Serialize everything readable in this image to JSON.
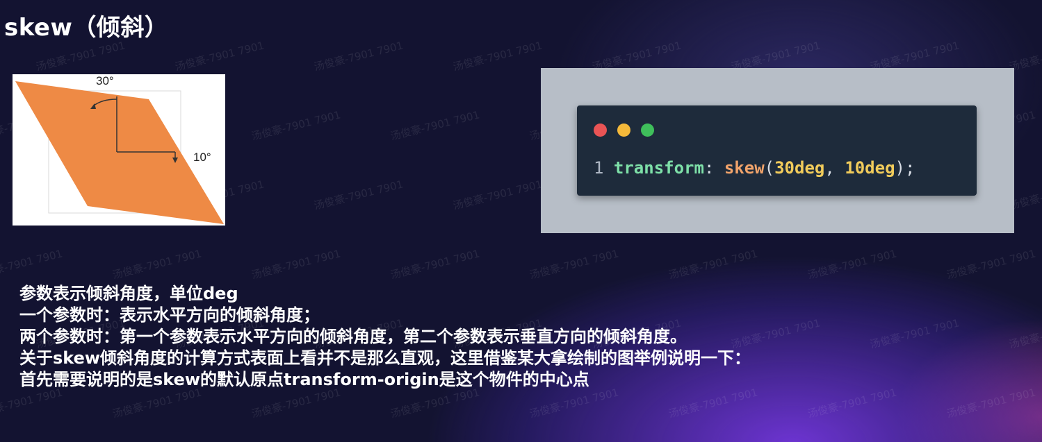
{
  "slide": {
    "title": "skew（倾斜）",
    "colors": {
      "diagram_shape": "#ee8a45",
      "code_panel_bg": "#b7bec7",
      "code_window_bg": "#1e2b3b",
      "dot_red": "#ea5455",
      "dot_yellow": "#f5b93a",
      "dot_green": "#3fbf5b"
    }
  },
  "diagram": {
    "angle_x_label": "30°",
    "angle_y_label": "10°"
  },
  "code": {
    "line_number": "1",
    "property": "transform",
    "colon": ":",
    "function": "skew",
    "open_paren": "(",
    "arg1": "30deg",
    "comma": ",",
    "arg2": "10deg",
    "close": ");"
  },
  "description": [
    "参数表示倾斜角度，单位deg",
    "一个参数时：表示水平方向的倾斜角度；",
    "两个参数时：第一个参数表示水平方向的倾斜角度，第二个参数表示垂直方向的倾斜角度。",
    "关于skew倾斜角度的计算方式表面上看并不是那么直观，这里借鉴某大拿绘制的图举例说明一下：",
    "首先需要说明的是skew的默认原点transform-origin是这个物件的中心点"
  ],
  "watermark_text": "汤俊豪-7901 7901"
}
